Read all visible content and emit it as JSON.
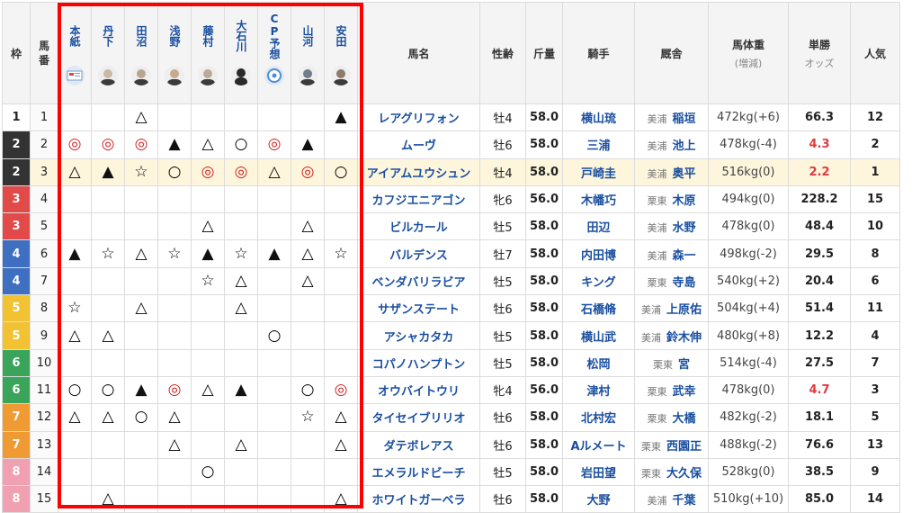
{
  "headers": {
    "waku": "枠",
    "umaban": "馬番",
    "horse": "馬名",
    "sexage": "性齢",
    "kinryo": "斤量",
    "jockey": "騎手",
    "stable": "厩舎",
    "weight_main": "馬体重",
    "weight_sub": "(増減)",
    "odds_main": "単勝",
    "odds_sub": "オッズ",
    "popularity": "人気"
  },
  "predictors": [
    {
      "name": "本紙",
      "avatar": "newspaper-icon",
      "color": "#dfe8f5"
    },
    {
      "name": "丹下",
      "avatar": "person-icon",
      "color": "#c9b9a6"
    },
    {
      "name": "田沼",
      "avatar": "person-icon",
      "color": "#b9a58f"
    },
    {
      "name": "浅野",
      "avatar": "person-icon",
      "color": "#c7a98d"
    },
    {
      "name": "藤村",
      "avatar": "person-icon",
      "color": "#bca997"
    },
    {
      "name": "大石川",
      "avatar": "silhouette-icon",
      "color": "#2a2a2a"
    },
    {
      "name": "CP予想",
      "avatar": "cp-logo-icon",
      "color": "#dfe8f5"
    },
    {
      "name": "山河",
      "avatar": "person-icon",
      "color": "#6f7d8c"
    },
    {
      "name": "安田",
      "avatar": "person-icon",
      "color": "#8c7a6a"
    }
  ],
  "frame_colors": {
    "1": {
      "bg": "#ffffff",
      "fg": "#222222"
    },
    "2": {
      "bg": "#333333",
      "fg": "#ffffff"
    },
    "3": {
      "bg": "#e24a4a",
      "fg": "#ffffff"
    },
    "4": {
      "bg": "#3f6fc1",
      "fg": "#ffffff"
    },
    "5": {
      "bg": "#f2c232",
      "fg": "#ffffff"
    },
    "6": {
      "bg": "#3aa55a",
      "fg": "#ffffff"
    },
    "7": {
      "bg": "#f09a34",
      "fg": "#ffffff"
    },
    "8": {
      "bg": "#f0a0b0",
      "fg": "#ffffff"
    }
  },
  "rows": [
    {
      "waku": "1",
      "umaban": "1",
      "marks": [
        "",
        "",
        "△",
        "",
        "",
        "",
        "",
        "",
        "▲"
      ],
      "horse": "レアグリフォン",
      "sexage": "牡4",
      "kinryo": "58.0",
      "jockey": "横山琉",
      "loc": "美浦",
      "trainer": "稲垣",
      "weight": "472kg(+6)",
      "odds": "66.3",
      "pop": "12",
      "hot": false,
      "hl": false
    },
    {
      "waku": "2",
      "umaban": "2",
      "marks": [
        "◎",
        "◎",
        "◎",
        "▲",
        "△",
        "○",
        "◎",
        "▲",
        ""
      ],
      "horse": "ムーヴ",
      "sexage": "牡6",
      "kinryo": "58.0",
      "jockey": "三浦",
      "loc": "美浦",
      "trainer": "池上",
      "weight": "478kg(-4)",
      "odds": "4.3",
      "pop": "2",
      "hot": true,
      "hl": false
    },
    {
      "waku": "2",
      "umaban": "3",
      "marks": [
        "△",
        "▲",
        "☆",
        "○",
        "◎",
        "◎",
        "△",
        "◎",
        "○"
      ],
      "horse": "アイアムユウシュン",
      "sexage": "牡4",
      "kinryo": "58.0",
      "jockey": "戸崎圭",
      "loc": "美浦",
      "trainer": "奥平",
      "weight": "516kg(0)",
      "odds": "2.2",
      "pop": "1",
      "hot": true,
      "hl": true
    },
    {
      "waku": "3",
      "umaban": "4",
      "marks": [
        "",
        "",
        "",
        "",
        "",
        "",
        "",
        "",
        ""
      ],
      "horse": "カフジエニアゴン",
      "sexage": "牝6",
      "kinryo": "56.0",
      "jockey": "木幡巧",
      "loc": "栗東",
      "trainer": "木原",
      "weight": "494kg(0)",
      "odds": "228.2",
      "pop": "15",
      "hot": false,
      "hl": false
    },
    {
      "waku": "3",
      "umaban": "5",
      "marks": [
        "",
        "",
        "",
        "",
        "△",
        "",
        "",
        "△",
        ""
      ],
      "horse": "ビルカール",
      "sexage": "牡5",
      "kinryo": "58.0",
      "jockey": "田辺",
      "loc": "美浦",
      "trainer": "水野",
      "weight": "478kg(0)",
      "odds": "48.4",
      "pop": "10",
      "hot": false,
      "hl": false
    },
    {
      "waku": "4",
      "umaban": "6",
      "marks": [
        "▲",
        "☆",
        "△",
        "☆",
        "▲",
        "☆",
        "▲",
        "△",
        "☆"
      ],
      "horse": "バルデンス",
      "sexage": "牡7",
      "kinryo": "58.0",
      "jockey": "内田博",
      "loc": "美浦",
      "trainer": "森一",
      "weight": "498kg(-2)",
      "odds": "29.5",
      "pop": "8",
      "hot": false,
      "hl": false
    },
    {
      "waku": "4",
      "umaban": "7",
      "marks": [
        "",
        "",
        "",
        "",
        "☆",
        "△",
        "",
        "△",
        ""
      ],
      "horse": "ベンダバリラビア",
      "sexage": "牡5",
      "kinryo": "58.0",
      "jockey": "キング",
      "loc": "栗東",
      "trainer": "寺島",
      "weight": "540kg(+2)",
      "odds": "20.4",
      "pop": "6",
      "hot": false,
      "hl": false
    },
    {
      "waku": "5",
      "umaban": "8",
      "marks": [
        "☆",
        "",
        "△",
        "",
        "",
        "△",
        "",
        "",
        ""
      ],
      "horse": "サザンステート",
      "sexage": "牡6",
      "kinryo": "58.0",
      "jockey": "石橋脩",
      "loc": "美浦",
      "trainer": "上原佑",
      "weight": "504kg(+4)",
      "odds": "51.4",
      "pop": "11",
      "hot": false,
      "hl": false
    },
    {
      "waku": "5",
      "umaban": "9",
      "marks": [
        "△",
        "△",
        "",
        "",
        "",
        "",
        "○",
        "",
        ""
      ],
      "horse": "アシャカタカ",
      "sexage": "牡5",
      "kinryo": "58.0",
      "jockey": "横山武",
      "loc": "美浦",
      "trainer": "鈴木伸",
      "weight": "480kg(+8)",
      "odds": "12.2",
      "pop": "4",
      "hot": false,
      "hl": false
    },
    {
      "waku": "6",
      "umaban": "10",
      "marks": [
        "",
        "",
        "",
        "",
        "",
        "",
        "",
        "",
        ""
      ],
      "horse": "コパノハンプトン",
      "sexage": "牡5",
      "kinryo": "58.0",
      "jockey": "松岡",
      "loc": "栗東",
      "trainer": "宮",
      "weight": "514kg(-4)",
      "odds": "27.5",
      "pop": "7",
      "hot": false,
      "hl": false
    },
    {
      "waku": "6",
      "umaban": "11",
      "marks": [
        "○",
        "○",
        "▲",
        "◎",
        "△",
        "▲",
        "",
        "○",
        "◎"
      ],
      "horse": "オウバイトウリ",
      "sexage": "牝4",
      "kinryo": "56.0",
      "jockey": "津村",
      "loc": "栗東",
      "trainer": "武幸",
      "weight": "478kg(0)",
      "odds": "4.7",
      "pop": "3",
      "hot": true,
      "hl": false
    },
    {
      "waku": "7",
      "umaban": "12",
      "marks": [
        "△",
        "△",
        "○",
        "△",
        "",
        "",
        "",
        "☆",
        "△"
      ],
      "horse": "タイセイブリリオ",
      "sexage": "牡6",
      "kinryo": "58.0",
      "jockey": "北村宏",
      "loc": "栗東",
      "trainer": "大橋",
      "weight": "482kg(-2)",
      "odds": "18.1",
      "pop": "5",
      "hot": false,
      "hl": false
    },
    {
      "waku": "7",
      "umaban": "13",
      "marks": [
        "",
        "",
        "",
        "△",
        "",
        "△",
        "",
        "",
        "△"
      ],
      "horse": "ダテボレアス",
      "sexage": "牡6",
      "kinryo": "58.0",
      "jockey": "Aルメート",
      "loc": "栗東",
      "trainer": "西園正",
      "weight": "488kg(-2)",
      "odds": "76.6",
      "pop": "13",
      "hot": false,
      "hl": false
    },
    {
      "waku": "8",
      "umaban": "14",
      "marks": [
        "",
        "",
        "",
        "",
        "○",
        "",
        "",
        "",
        ""
      ],
      "horse": "エメラルドビーチ",
      "sexage": "牡5",
      "kinryo": "58.0",
      "jockey": "岩田望",
      "loc": "栗東",
      "trainer": "大久保",
      "weight": "528kg(0)",
      "odds": "38.5",
      "pop": "9",
      "hot": false,
      "hl": false
    },
    {
      "waku": "8",
      "umaban": "15",
      "marks": [
        "",
        "△",
        "",
        "",
        "",
        "",
        "",
        "",
        "△"
      ],
      "horse": "ホワイトガーベラ",
      "sexage": "牡6",
      "kinryo": "58.0",
      "jockey": "大野",
      "loc": "美浦",
      "trainer": "千葉",
      "weight": "510kg(+10)",
      "odds": "85.0",
      "pop": "14",
      "hot": false,
      "hl": false
    }
  ]
}
